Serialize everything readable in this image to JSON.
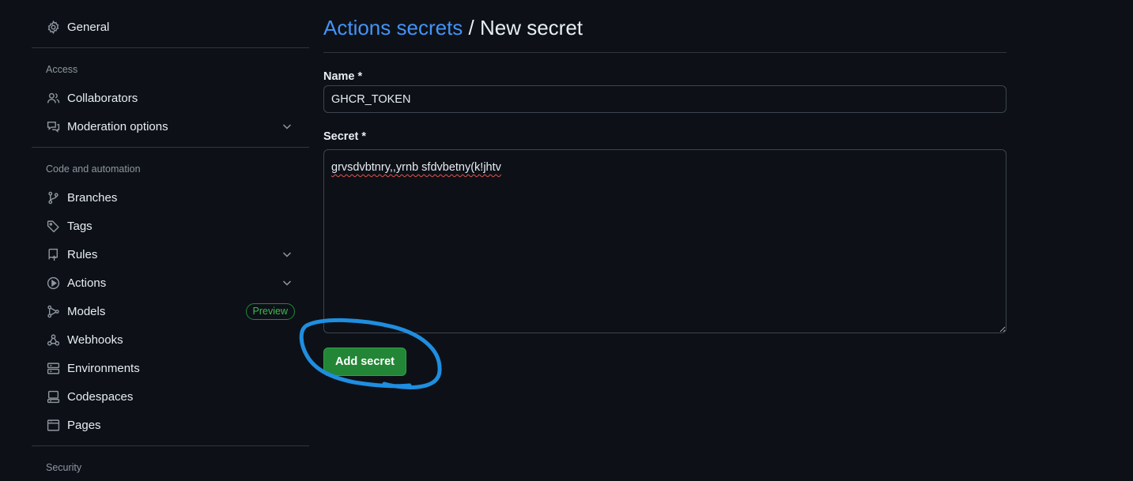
{
  "sidebar": {
    "general": {
      "label": "General",
      "icon": "gear-icon"
    },
    "sections": {
      "access": "Access",
      "code_automation": "Code and automation",
      "security": "Security"
    },
    "items": {
      "collaborators": {
        "label": "Collaborators",
        "icon": "people-icon"
      },
      "moderation": {
        "label": "Moderation options",
        "icon": "comment-discussion-icon"
      },
      "branches": {
        "label": "Branches",
        "icon": "git-branch-icon"
      },
      "tags": {
        "label": "Tags",
        "icon": "tag-icon"
      },
      "rules": {
        "label": "Rules",
        "icon": "repo-push-icon"
      },
      "actions": {
        "label": "Actions",
        "icon": "play-icon"
      },
      "models": {
        "label": "Models",
        "icon": "models-icon",
        "badge": "Preview"
      },
      "webhooks": {
        "label": "Webhooks",
        "icon": "webhook-icon"
      },
      "environments": {
        "label": "Environments",
        "icon": "server-icon"
      },
      "codespaces": {
        "label": "Codespaces",
        "icon": "codespaces-icon"
      },
      "pages": {
        "label": "Pages",
        "icon": "browser-icon"
      }
    }
  },
  "main": {
    "breadcrumb_link": "Actions secrets",
    "breadcrumb_sep": " / ",
    "breadcrumb_current": "New secret",
    "name_label": "Name *",
    "name_value": "GHCR_TOKEN",
    "secret_label": "Secret *",
    "secret_value": "grvsdvbtnry,,yrnb sfdvbetny(k!jhtv",
    "submit_label": "Add secret"
  },
  "colors": {
    "background": "#0d1117",
    "link": "#4493f8",
    "primary_button": "#238636",
    "annotation_circle": "#1f8ee0"
  }
}
